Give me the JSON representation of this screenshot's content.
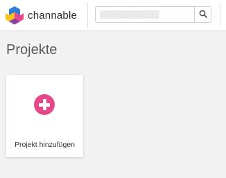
{
  "header": {
    "logo_text": "channable",
    "search": {
      "value": "",
      "placeholder": "▒▒▒▒▒▒▒▒▒▒▒"
    },
    "search_icon": "search-icon"
  },
  "main": {
    "title": "Projekte",
    "add_project": {
      "label": "Projekt hinzufügen",
      "icon": "plus-circle-icon"
    }
  },
  "colors": {
    "accent": "#e6488c",
    "logo_blue": "#2f7fd6",
    "logo_yellow": "#f7c31b",
    "logo_pink": "#e6488c",
    "background": "#f2f2f2"
  }
}
